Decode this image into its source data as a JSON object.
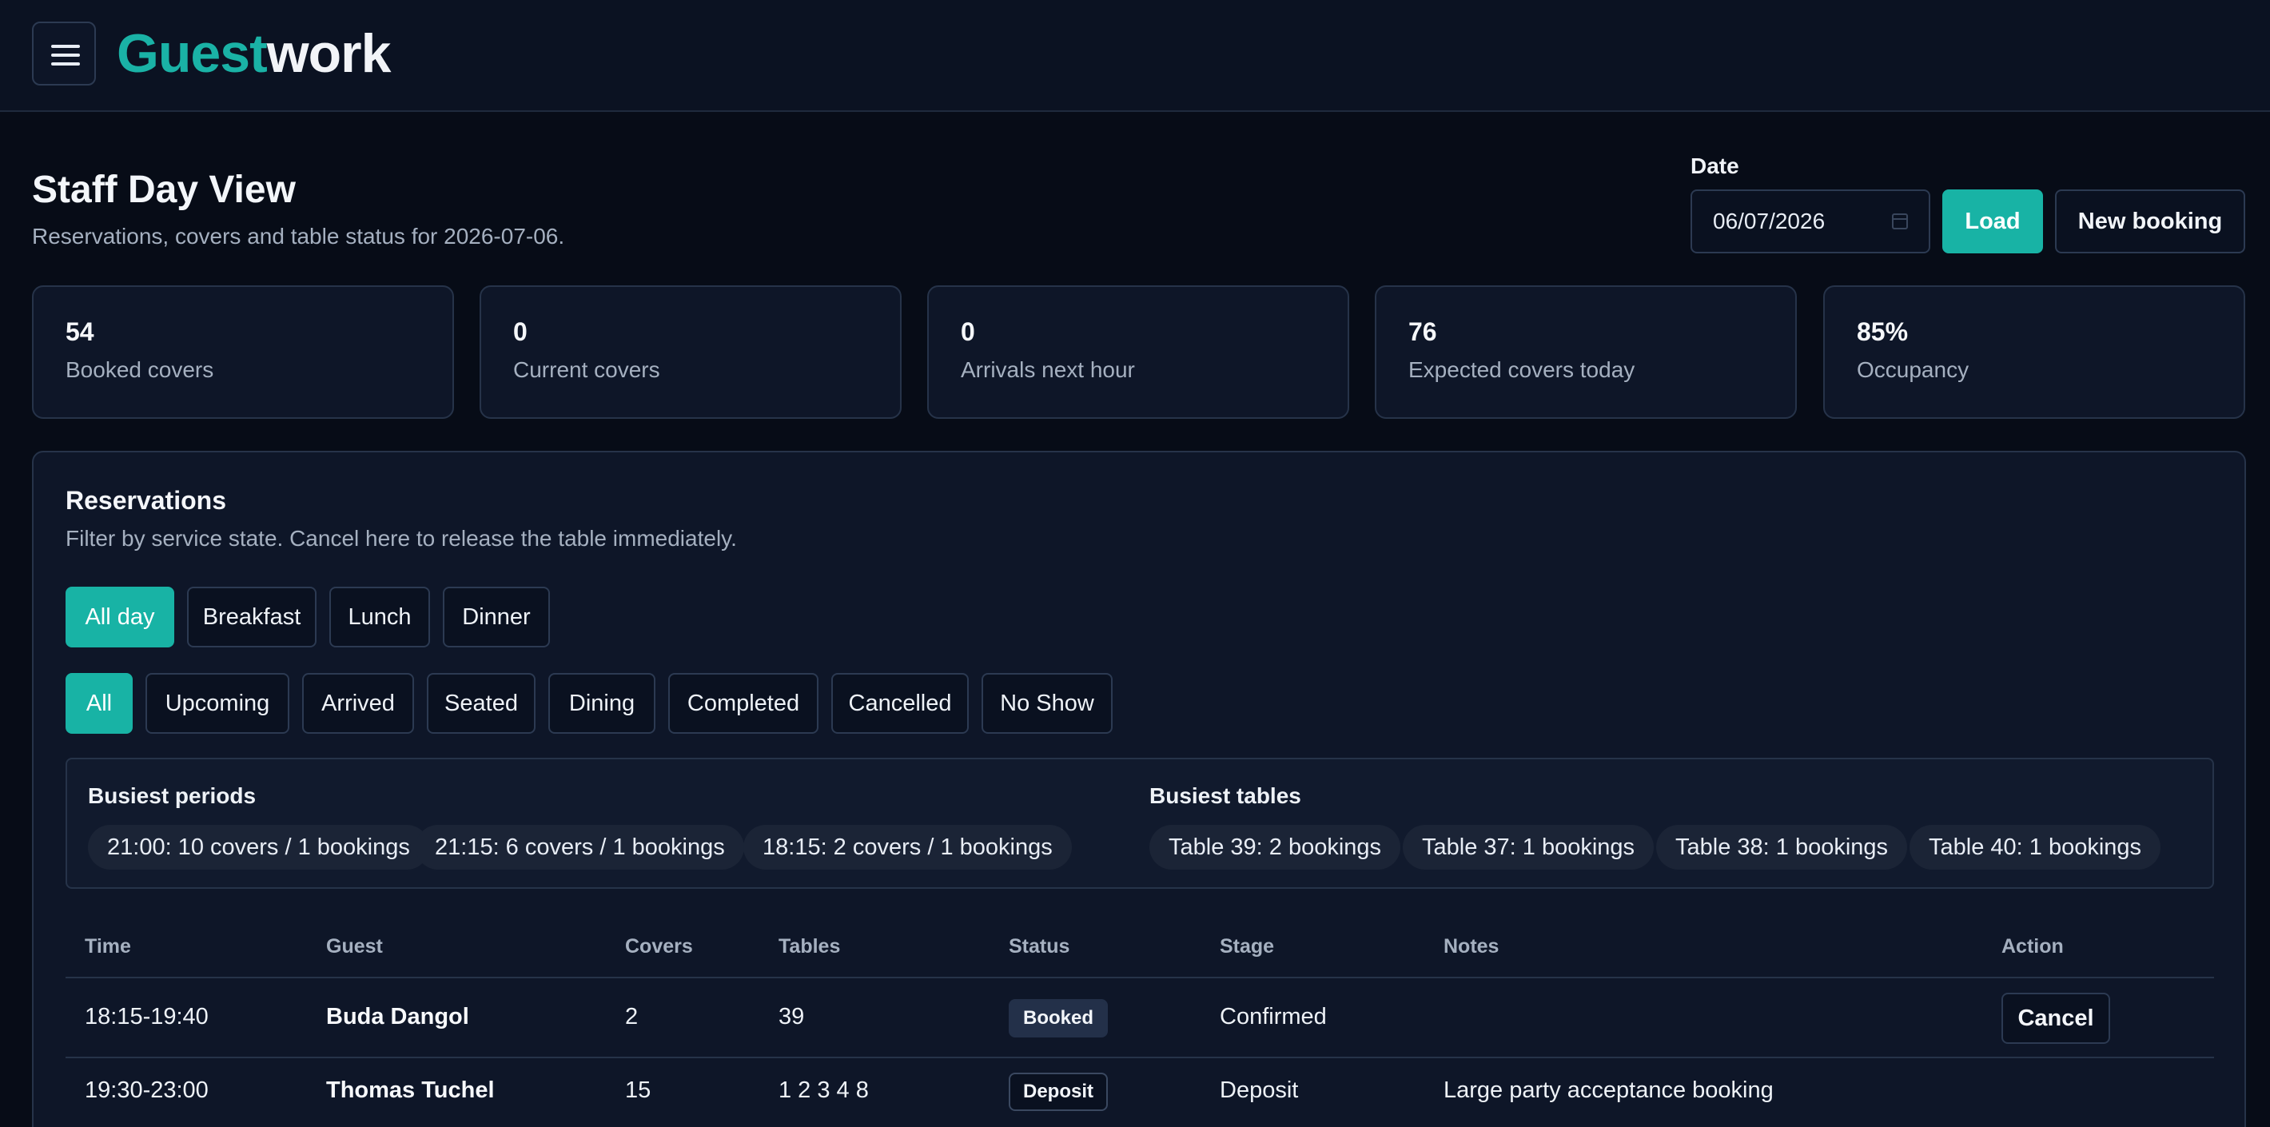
{
  "app": {
    "logo_part1": "Guest",
    "logo_part2": "work"
  },
  "colors": {
    "accent": "#18b3a5",
    "background": "#070c17",
    "card": "#0e1628"
  },
  "icons": {
    "menu": "hamburger-menu-icon",
    "date": "calendar-icon"
  },
  "header": {
    "title": "Staff Day View",
    "subtitle": "Reservations, covers and table status for 2026-07-06."
  },
  "date_picker": {
    "label": "Date",
    "value": "06/07/2026",
    "load_label": "Load",
    "new_booking_label": "New booking"
  },
  "stats": [
    {
      "value": "54",
      "label": "Booked covers"
    },
    {
      "value": "0",
      "label": "Current covers"
    },
    {
      "value": "0",
      "label": "Arrivals next hour"
    },
    {
      "value": "76",
      "label": "Expected covers today"
    },
    {
      "value": "85%",
      "label": "Occupancy"
    }
  ],
  "reservations": {
    "title": "Reservations",
    "subtitle": "Filter by service state. Cancel here to release the table immediately.",
    "service_filters": [
      "All day",
      "Breakfast",
      "Lunch",
      "Dinner"
    ],
    "service_active": "All day",
    "status_filters": [
      "All",
      "Upcoming",
      "Arrived",
      "Seated",
      "Dining",
      "Completed",
      "Cancelled",
      "No Show"
    ],
    "status_active": "All",
    "busiest_periods": {
      "title": "Busiest periods",
      "items": [
        "21:00: 10 covers / 1 bookings",
        "21:15: 6 covers / 1 bookings",
        "18:15: 2 covers / 1 bookings"
      ]
    },
    "busiest_tables": {
      "title": "Busiest tables",
      "items": [
        "Table 39: 2 bookings",
        "Table 37: 1 bookings",
        "Table 38: 1 bookings",
        "Table 40: 1 bookings"
      ]
    },
    "columns": [
      "Time",
      "Guest",
      "Covers",
      "Tables",
      "Status",
      "Stage",
      "Notes",
      "Action"
    ],
    "rows": [
      {
        "time": "18:15-19:40",
        "guest": "Buda Dangol",
        "covers": "2",
        "tables": "39",
        "status": "Booked",
        "stage": "Confirmed",
        "notes": "",
        "action": "Cancel"
      },
      {
        "time": "19:30-23:00",
        "guest": "Thomas Tuchel",
        "covers": "15",
        "tables": "1 2 3 4 8",
        "status": "Deposit",
        "stage": "Deposit",
        "notes": "Large party acceptance booking",
        "action": ""
      }
    ]
  }
}
